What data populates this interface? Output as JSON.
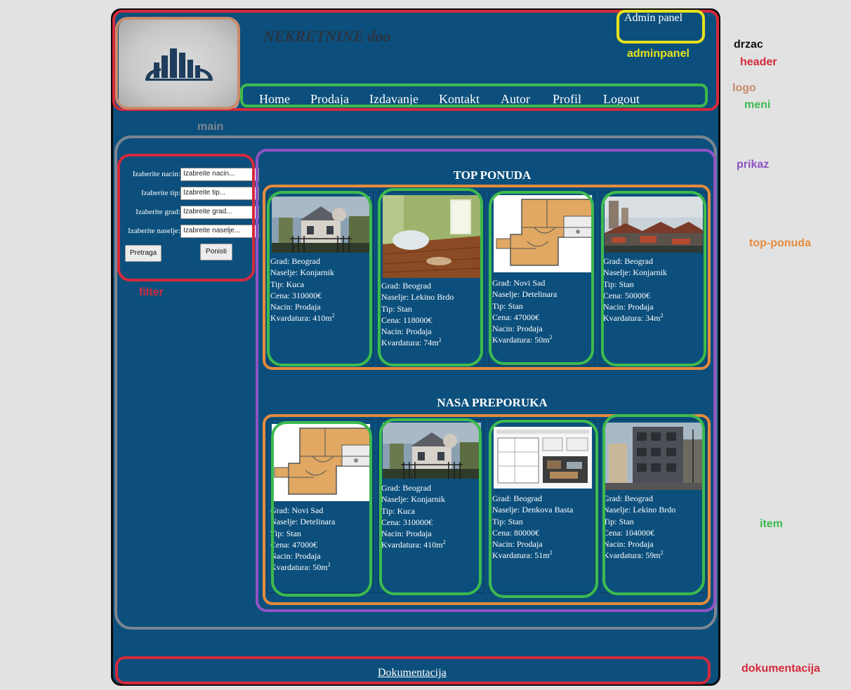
{
  "header": {
    "site_title": "NEKRETNINE doo",
    "admin_link": "Admin panel",
    "nav": [
      "Home",
      "Prodaja",
      "Izdavanje",
      "Kontakt",
      "Autor",
      "Profil",
      "Logout"
    ]
  },
  "filter": {
    "rows": [
      {
        "label": "Izaberite nacin:",
        "value": "Izabreite nacin..."
      },
      {
        "label": "Izaberite tip:",
        "value": "Izabreite tip..."
      },
      {
        "label": "Izaberite grad:",
        "value": "Izabreite grad..."
      },
      {
        "label": "Izaberite naselje:",
        "value": "Izabreite naselje..."
      }
    ],
    "search_button": "Pretraga",
    "reset_button": "Ponisti"
  },
  "sections": {
    "top_title": "TOP PONUDA",
    "recommend_title": "NASA PREPORUKA"
  },
  "top_items": [
    {
      "photo": "house",
      "lines": [
        "Grad: Beograd",
        "Naselje: Konjarnik",
        "Tip: Kuca",
        "Cena: 310000€",
        "Nacin: Prodaja"
      ],
      "area": "Kvardatura: 410m"
    },
    {
      "photo": "interior",
      "lines": [
        "Grad: Beograd",
        "Naselje: Lekino Brdo",
        "Tip: Stan",
        "Cena: 118000€",
        "Nacin: Prodaja"
      ],
      "area": "Kvardatura: 74m"
    },
    {
      "photo": "floorplan",
      "lines": [
        "Grad: Novi Sad",
        "Naselje: Detelinara",
        "Tip: Stan",
        "Cena: 47000€",
        "Nacin: Prodaja"
      ],
      "area": "Kvardatura: 50m"
    },
    {
      "photo": "city",
      "lines": [
        "Grad: Beograd",
        "Naselje: Konjarnik",
        "Tip: Stan",
        "Cena: 50000€",
        "Nacin: Prodaja"
      ],
      "area": "Kvardatura: 34m"
    }
  ],
  "recommend_items": [
    {
      "photo": "floorplan",
      "lines": [
        "Grad: Novi Sad",
        "Naselje: Detelinara",
        "Tip: Stan",
        "Cena: 47000€",
        "Nacin: Prodaja"
      ],
      "area": "Kvardatura: 50m"
    },
    {
      "photo": "house",
      "lines": [
        "Grad: Beograd",
        "Naselje: Konjarnik",
        "Tip: Kuca",
        "Cena: 310000€",
        "Nacin: Prodaja"
      ],
      "area": "Kvardatura: 410m"
    },
    {
      "photo": "plan-sheet",
      "lines": [
        "Grad: Beograd",
        "Naselje: Denkova Basta",
        "Tip: Stan",
        "Cena: 80000€",
        "Nacin: Prodaja"
      ],
      "area": "Kvardatura: 51m"
    },
    {
      "photo": "building",
      "lines": [
        "Grad: Beograd",
        "Naselje: Lekino Brdo",
        "Tip: Stan",
        "Cena: 104000€",
        "Nacin: Prodaja"
      ],
      "area": "Kvardatura: 59m"
    }
  ],
  "area_unit_exponent": "2",
  "footer": {
    "link": "Dokumentacija"
  },
  "annotations": {
    "drzac": "drzac",
    "header": "header",
    "logo": "logo",
    "meni": "meni",
    "adminpanel": "adminpanel",
    "main": "main",
    "prikaz": "prikaz",
    "top_ponuda": "top-ponuda",
    "filter": "filter",
    "item": "item",
    "dokumentacija": "dokumentacija"
  },
  "colors": {
    "page_bg": "#0c4f7c",
    "header": "#d42a3c",
    "logo": "#c98a6a",
    "meni": "#3dba4e",
    "adminpanel": "#e6e21e",
    "prikaz": "#8e54c6",
    "top_ponuda": "#e58b3d",
    "main": "#7c8690"
  }
}
